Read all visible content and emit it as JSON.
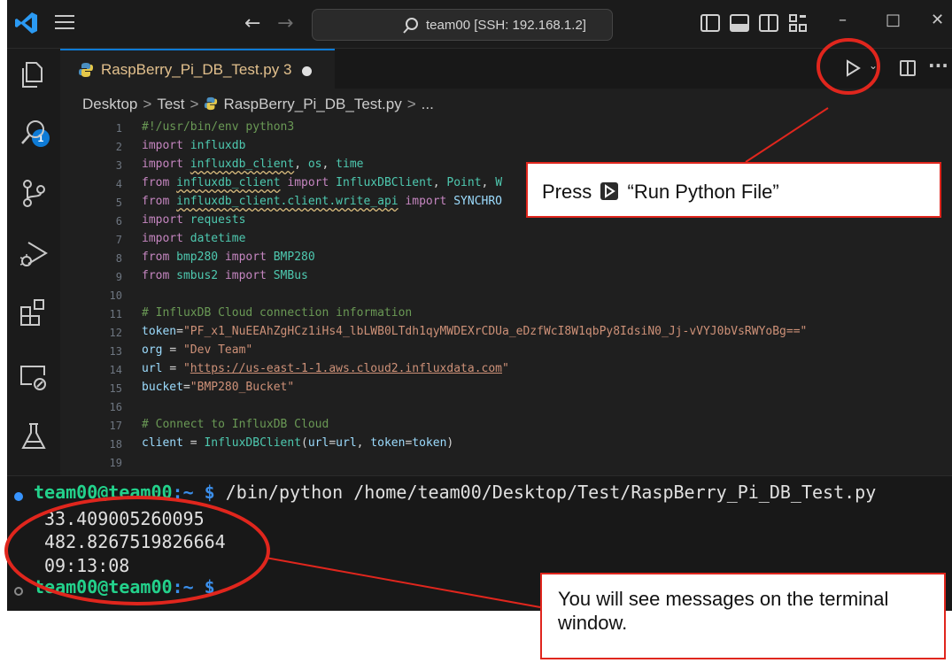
{
  "titlebar": {
    "search_text": "team00 [SSH: 192.168.1.2]",
    "back_glyph": "←",
    "forward_glyph": "→",
    "minimize_glyph": "–",
    "maximize_glyph": "□",
    "close_glyph": "✕"
  },
  "activity": {
    "explorer_badge": "1",
    "icons": [
      "explorer-icon",
      "search-icon",
      "source-control-icon",
      "run-debug-icon",
      "extensions-icon",
      "remote-explorer-icon",
      "testing-icon"
    ]
  },
  "tab": {
    "filename": "RaspBerry_Pi_DB_Test.py",
    "problems": "3"
  },
  "breadcrumb": {
    "items": [
      "Desktop",
      "Test",
      "RaspBerry_Pi_DB_Test.py",
      "..."
    ],
    "separator": ">"
  },
  "editor": {
    "line_numbers": [
      "1",
      "2",
      "3",
      "4",
      "5",
      "6",
      "7",
      "8",
      "9",
      "10",
      "11",
      "12",
      "13",
      "14",
      "15",
      "16",
      "17",
      "18",
      "19"
    ],
    "lines": [
      "#!/usr/bin/env python3",
      "import influxdb",
      "import influxdb_client, os, time",
      "from influxdb_client import InfluxDBClient, Point, W",
      "from influxdb_client.client.write_api import SYNCHRO",
      "import requests",
      "import datetime",
      "from bmp280 import BMP280",
      "from smbus2 import SMBus",
      "",
      "# InfluxDB Cloud connection information",
      "token=\"PF_x1_NuEEAhZgHCz1iHs4_lbLWB0LTdh1qyMWDEXrCDUa_eDzfWcI8W1qbPy8IdsiN0_Jj-vVYJ0bVsRWYoBg==\"",
      "org = \"Dev Team\"",
      "url = \"https://us-east-1-1.aws.cloud2.influxdata.com\"",
      "bucket=\"BMP280_Bucket\"",
      "",
      "# Connect to InfluxDB Cloud",
      "client = InfluxDBClient(url=url, token=token)",
      ""
    ]
  },
  "terminal": {
    "prompt_user": "team00@team00",
    "prompt_path": ":~ $",
    "command": " /bin/python /home/team00/Desktop/Test/RaspBerry_Pi_DB_Test.py",
    "output": [
      "33.409005260095",
      "482.8267519826664",
      "09:13:08"
    ],
    "prompt2_user": "team00@team00",
    "prompt2_path": ":~ $"
  },
  "callouts": {
    "run_prefix": "Press",
    "run_label": "“Run Python File”",
    "terminal_note": "You will see messages on the terminal window."
  },
  "colors": {
    "accent": "#0e7bd6",
    "annotation": "#e0261d",
    "prompt_green": "#23d18b",
    "tab_modified": "#e2c08d"
  }
}
